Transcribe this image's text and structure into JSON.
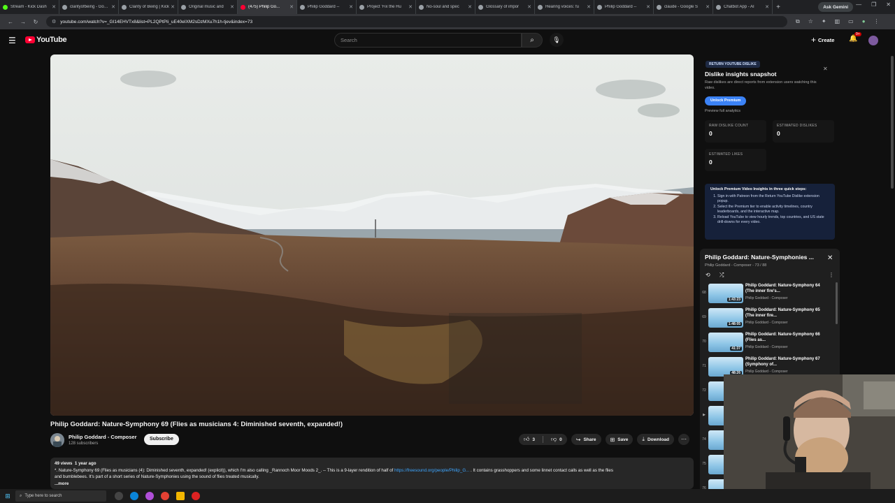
{
  "browser": {
    "tabs": [
      {
        "label": "Stream - Kick Dash",
        "fav": "green"
      },
      {
        "label": "clarityofbeing - Google",
        "fav": "grey"
      },
      {
        "label": "Clarity of Being | Kick",
        "fav": "grey"
      },
      {
        "label": "Original music and",
        "fav": "grey"
      },
      {
        "label": "(475) Philip Go...",
        "fav": "yt",
        "active": true
      },
      {
        "label": "Philip Goddard -- ",
        "fav": "grey"
      },
      {
        "label": "Project 'Fix the Hu",
        "fav": "grey"
      },
      {
        "label": "No-soul and spec",
        "fav": "grey"
      },
      {
        "label": "Glossary of impor",
        "fav": "grey"
      },
      {
        "label": "Hearing voices: fu",
        "fav": "grey"
      },
      {
        "label": "Philip Goddard -- ",
        "fav": "grey"
      },
      {
        "label": "claude - Google S",
        "fav": "grey"
      },
      {
        "label": "Chatbot App - AI",
        "fav": "grey"
      }
    ],
    "gemini_label": "Ask Gemini",
    "url": "youtube.com/watch?v=_GI14EHVTx8&list=PL2QPtPIi_uE40eIXM2sDzMXu7h1h-tjev&index=73"
  },
  "header": {
    "logo_text": "YouTube",
    "search_placeholder": "Search",
    "create_label": "Create",
    "notif_badge": "9+"
  },
  "video": {
    "title": "Philip Goddard: Nature-Symphony 69 (Flies as musicians 4: Diminished seventh, expanded!)",
    "channel": "Philip Goddard - Composer",
    "subscribers": "128 subscribers",
    "subscribe_label": "Subscribe",
    "likes": "3",
    "dislikes": "0",
    "share_label": "Share",
    "save_label": "Save",
    "download_label": "Download",
    "views": "49 views",
    "age": "1 year ago",
    "desc_line1_pre": "*. Nature-Symphony 69 (Flies as musicians (4): Diminished seventh, expanded! (explicit)), which I'm also calling _Rannoch Moor Moods 2_. -- This is a 9-layer rendition of half of ",
    "desc_link": "https://freesound.org/people/Philip_G...",
    "desc_line1_post": " . It contains grasshoppers and some linnet contact calls as well as the flies",
    "desc_line2": "and bumblebees. It's part of a short series of Nature-Symphonies using the sound of flies treated musically.",
    "more_label": "...more"
  },
  "extension": {
    "tag": "RETURN YOUTUBE DISLIKE",
    "heading": "Dislike insights snapshot",
    "text": "Raw dislikes are direct reports from extension users watching this video.",
    "unlock_label": "Unlock Premium",
    "preview_label": "Preview full analytics",
    "stats": [
      {
        "label": "RAW DISLIKE COUNT",
        "value": "0"
      },
      {
        "label": "ESTIMATED DISLIKES",
        "value": "0"
      },
      {
        "label": "ESTIMATED LIKES",
        "value": "0"
      }
    ],
    "steps_title": "Unlock Premium Video Insights in three quick steps:",
    "steps": [
      "Sign in with Patreon from the Return YouTube Dislike extension popup.",
      "Select the Premium tier to enable activity timelines, country leaderboards, and the interactive map.",
      "Reload YouTube to view hourly trends, top countries, and US state drill-downs for every video."
    ]
  },
  "playlist": {
    "title": "Philip Goddard: Nature-Symphonies ...",
    "subtitle": "Philip Goddard - Composer - 73 / 88",
    "items": [
      {
        "index": "68",
        "title": "Philip Goddard: Nature-Symphony 64 (The inner fire's...",
        "channel": "Philip Goddard - Composer",
        "duration": "1:43:23"
      },
      {
        "index": "69",
        "title": "Philip Goddard: Nature-Symphony 65 (The inner fire...",
        "channel": "Philip Goddard - Composer",
        "duration": "1:48:05"
      },
      {
        "index": "70",
        "title": "Philip Goddard: Nature-Symphony 66 (Flies as...",
        "channel": "Philip Goddard - Composer",
        "duration": "41:37"
      },
      {
        "index": "71",
        "title": "Philip Goddard: Nature-Symphony 67 (Symphony of...",
        "channel": "Philip Goddard - Composer",
        "duration": "48:26"
      },
      {
        "index": "72",
        "title": "",
        "channel": "",
        "duration": ""
      },
      {
        "index": "▶",
        "title": "",
        "channel": "",
        "duration": ""
      },
      {
        "index": "74",
        "title": "",
        "channel": "",
        "duration": ""
      },
      {
        "index": "75",
        "title": "",
        "channel": "",
        "duration": ""
      },
      {
        "index": "76",
        "title": "",
        "channel": "",
        "duration": ""
      }
    ]
  },
  "taskbar": {
    "search_placeholder": "Type here to search"
  },
  "colors": {
    "yt_red": "#ff0033",
    "link_blue": "#3ea6ff",
    "ext_button": "#3b82f6"
  }
}
